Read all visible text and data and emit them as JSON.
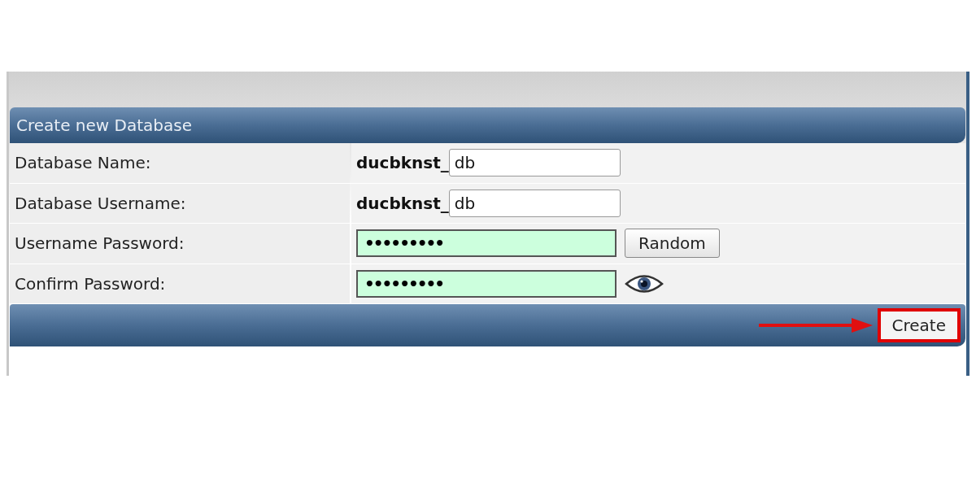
{
  "panel": {
    "title": "Create new Database",
    "rows": [
      {
        "kind": "prefixed",
        "label": "Database Name:",
        "prefix": "ducbknst_",
        "value": "db"
      },
      {
        "kind": "prefixed",
        "label": "Database Username:",
        "prefix": "ducbknst_",
        "value": "db"
      },
      {
        "kind": "password",
        "label": "Username Password:",
        "value": "•••••••••",
        "action": {
          "kind": "button",
          "label": "Random"
        }
      },
      {
        "kind": "password",
        "label": "Confirm Password:",
        "value": "•••••••••",
        "action": {
          "kind": "reveal"
        }
      }
    ],
    "footer": {
      "button": {
        "label": "Create",
        "highlighted": true
      },
      "annotation_arrow": true
    }
  }
}
